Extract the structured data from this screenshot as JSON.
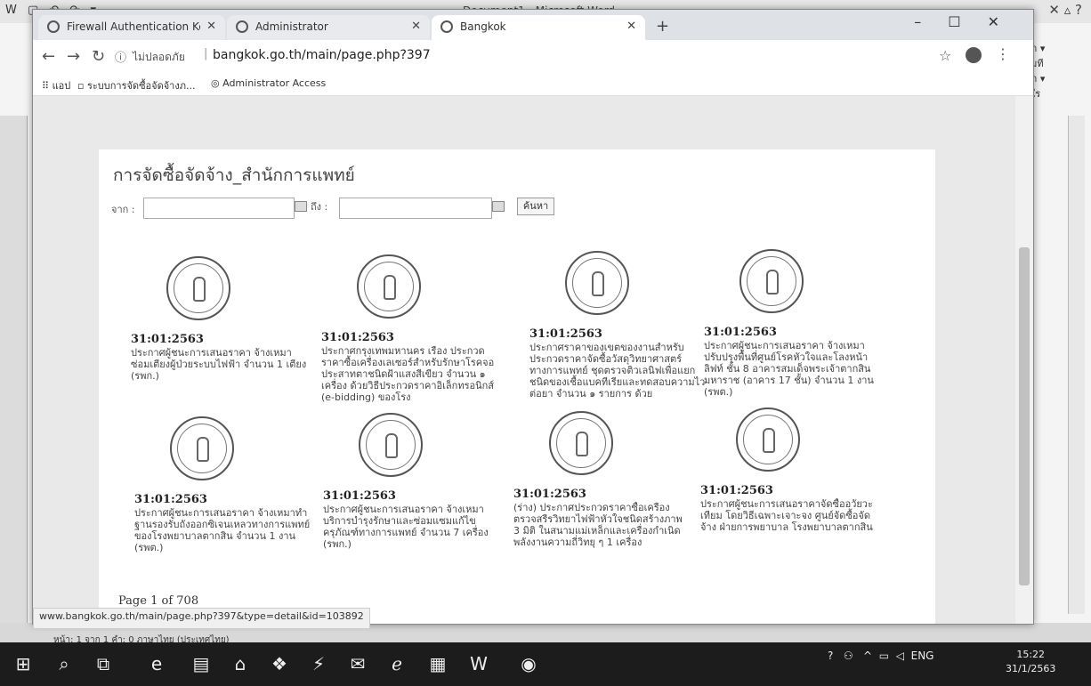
{
  "word": {
    "title": "Document1 - Microsoft Word",
    "qat": "W ▢ ↶ ↷ ▾",
    "right_icons": "✕ ▵ ?",
    "ribbon_right": [
      "ทา ▾",
      "ามที",
      "ภา ▾",
      "ร์ใร"
    ],
    "status_text": "หน้า: 1 จาก 1   คำ: 0   ภาษาไทย (ประเทศไทย)"
  },
  "taskbar": {
    "icons": [
      "windows-start",
      "search",
      "task-view",
      "edge",
      "file-explorer",
      "store",
      "dropbox",
      "pinned-app",
      "mail",
      "ie",
      "photos",
      "word",
      "chrome"
    ],
    "tray_text": "ENG",
    "time": "15:22",
    "date": "31/1/2563"
  },
  "chrome": {
    "tabs": [
      {
        "label": "Firewall Authentication Keepalive",
        "active": false
      },
      {
        "label": "Administrator",
        "active": false
      },
      {
        "label": "Bangkok",
        "active": true
      }
    ],
    "insecure_label": "ไม่ปลอดภัย",
    "url": "bangkok.go.th/main/page.php?397",
    "bookmarks": [
      "แอป",
      "ระบบการจัดซื้อจัดจ้างภ...",
      "Administrator Access"
    ],
    "status_url": "www.bangkok.go.th/main/page.php?397&type=detail&id=103892"
  },
  "page": {
    "title": "การจัดซื้อจัดจ้าง_สำนักการแพทย์",
    "from_label": "จาก :",
    "to_label": "ถึง :",
    "search_button": "ค้นหา",
    "items": [
      {
        "date": "31:01:2563",
        "text": "ประกาศผู้ชนะการเสนอราคา จ้างเหมาซ่อมเตียงผู้ป่วยระบบไฟฟ้า จำนวน 1 เตียง (รพก.)"
      },
      {
        "date": "31:01:2563",
        "text": "ประกาศกรุงเทพมหานคร เรื่อง ประกวดราคาซื้อเครื่องเลเซอร์สำหรับรักษาโรคจอประสาทตาชนิดฝ้าแสงสีเขียว จำนวน ๑ เครื่อง ด้วยวิธีประกวดราคาอิเล็กทรอนิกส์ (e-bidding) ของโรง"
      },
      {
        "date": "31:01:2563",
        "text": "ประกาศราคาของเขตของงานสำหรับประกวดราคาจัดซื้อวัสดุวิทยาศาสตร์ทางการแพทย์ ชุดตรวจติวเลนิฟเพื่อแยกชนิดของเชื้อแบคทีเรียและทดสอบความไวต่อยา จำนวน ๑ รายการ ด้วย"
      },
      {
        "date": "31:01:2563",
        "text": "ประกาศผู้ชนะการเสนอราคา จ้างเหมาปรับปรุงพื้นที่ศูนย์โรคหัวใจและโลงหน้าลิฟท์ ชั้น 8 อาคารสมเด็จพระเจ้าตากสินมหาราช (อาคาร 17 ชั้น) จำนวน 1 งาน (รพต.)"
      },
      {
        "date": "31:01:2563",
        "text": "ประกาศผู้ชนะการเสนอราคา จ้างเหมาทำฐานรองรับถังออกซิเจนเหลวทางการแพทย์ ของโรงพยาบาลตากสิน จำนวน 1 งาน (รพต.)"
      },
      {
        "date": "31:01:2563",
        "text": "ประกาศผู้ชนะการเสนอราคา จ้างเหมาบริการบำรุงรักษาและซ่อมแซมแก้ไขครุภัณฑ์ทางการแพทย์ จำนวน 7 เครื่อง (รพก.)"
      },
      {
        "date": "31:01:2563",
        "text": "(ร่าง) ประกาศประกวดราคาซื้อเครื่องตรวจสรีรวิทยาไฟฟ้าหัวใจชนิดสร้างภาพ 3 มิติ ในสนามแม่เหล็กและเครื่องกำเนิดพลังงานความถี่วิทยุ ๆ 1 เครื่อง"
      },
      {
        "date": "31:01:2563",
        "text": "ประกาศผู้ชนะการเสนอราคาจัดซื้ออวัยวะเทียม โดยวิธีเฉพาะเจาะจง ศูนย์จัดซื้อจัดจ้าง ฝ่ายการพยาบาล โรงพยาบาลตากสิน"
      }
    ],
    "pager": {
      "label": "Page",
      "current": "1",
      "of": "of",
      "total": "708"
    }
  }
}
